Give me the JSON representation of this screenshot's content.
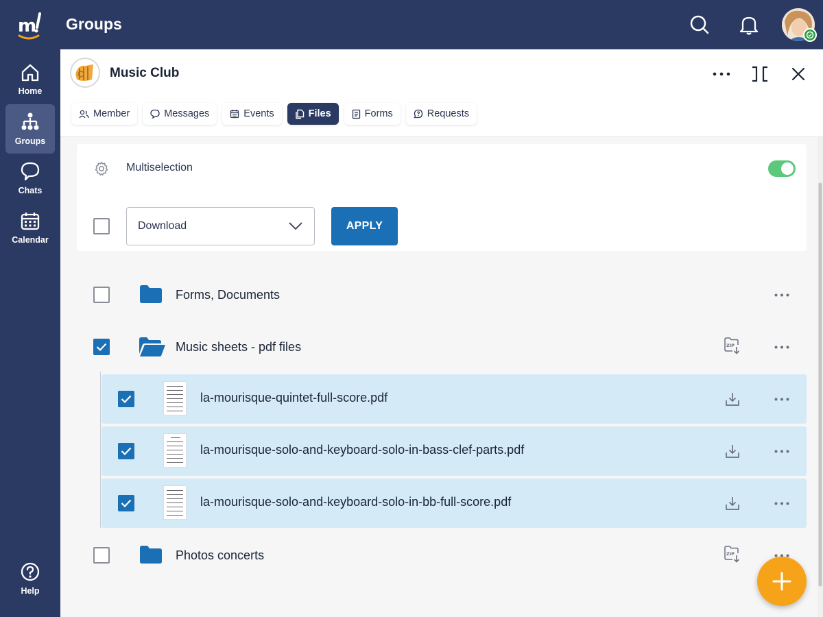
{
  "app": {
    "title": "Groups"
  },
  "sidenav": {
    "items": [
      {
        "label": "Home",
        "icon": "home-icon"
      },
      {
        "label": "Groups",
        "icon": "groups-icon",
        "active": true
      },
      {
        "label": "Chats",
        "icon": "chat-icon"
      },
      {
        "label": "Calendar",
        "icon": "calendar-icon"
      }
    ],
    "help_label": "Help"
  },
  "group": {
    "name": "Music Club"
  },
  "tabs": [
    {
      "label": "Member",
      "icon": "member-icon"
    },
    {
      "label": "Messages",
      "icon": "messages-icon"
    },
    {
      "label": "Events",
      "icon": "events-icon"
    },
    {
      "label": "Files",
      "icon": "files-icon",
      "active": true
    },
    {
      "label": "Forms",
      "icon": "forms-icon"
    },
    {
      "label": "Requests",
      "icon": "requests-icon"
    }
  ],
  "multiselection": {
    "label": "Multiselection",
    "enabled": true,
    "action_value": "Download",
    "apply_label": "APPLY"
  },
  "files": {
    "folders": [
      {
        "name": "Forms, Documents",
        "checked": false,
        "open": false
      },
      {
        "name": "Music sheets - pdf files",
        "checked": true,
        "open": true
      },
      {
        "name": "Photos concerts",
        "checked": false,
        "open": false
      }
    ],
    "children": [
      {
        "name": "la-mourisque-quintet-full-score.pdf",
        "checked": true
      },
      {
        "name": "la-mourisque-solo-and-keyboard-solo-in-bass-clef-parts.pdf",
        "checked": true
      },
      {
        "name": "la-mourisque-solo-and-keyboard-solo-in-bb-full-score.pdf",
        "checked": true
      }
    ]
  },
  "colors": {
    "nav_bg": "#2b3a62",
    "accent_blue": "#1a6fb5",
    "selected_row": "#d4eaf7",
    "toggle_on": "#5cc87a",
    "fab": "#f7a31a"
  }
}
